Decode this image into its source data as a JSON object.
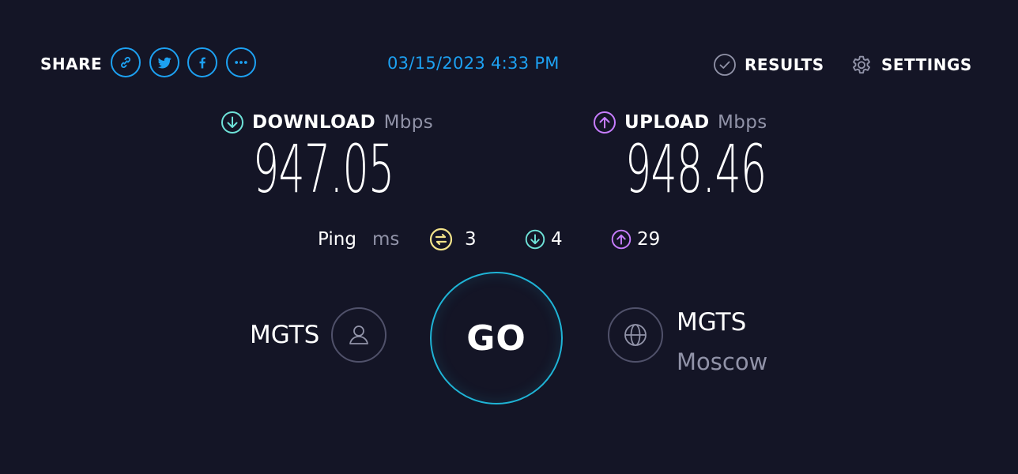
{
  "share": {
    "label": "SHARE",
    "buttons": [
      {
        "icon": "link-icon"
      },
      {
        "icon": "twitter-icon"
      },
      {
        "icon": "facebook-icon"
      },
      {
        "icon": "more-icon"
      }
    ]
  },
  "timestamp": "03/15/2023 4:33 PM",
  "nav": {
    "results_label": "RESULTS",
    "settings_label": "SETTINGS"
  },
  "download": {
    "label": "DOWNLOAD",
    "unit": "Mbps",
    "value": "947.05",
    "color": "#6ee2d8"
  },
  "upload": {
    "label": "UPLOAD",
    "unit": "Mbps",
    "value": "948.46",
    "color": "#c77dff"
  },
  "ping": {
    "label": "Ping",
    "unit": "ms",
    "idle": "3",
    "download": "4",
    "upload": "29",
    "idle_color": "#f3e38a"
  },
  "go_label": "GO",
  "isp": {
    "name": "MGTS"
  },
  "server": {
    "name": "MGTS",
    "location": "Moscow"
  },
  "colors": {
    "background": "#141526",
    "accent_blue": "#1da1f2",
    "go_ring": "#1fb4d6",
    "muted_text": "#9193a8"
  }
}
